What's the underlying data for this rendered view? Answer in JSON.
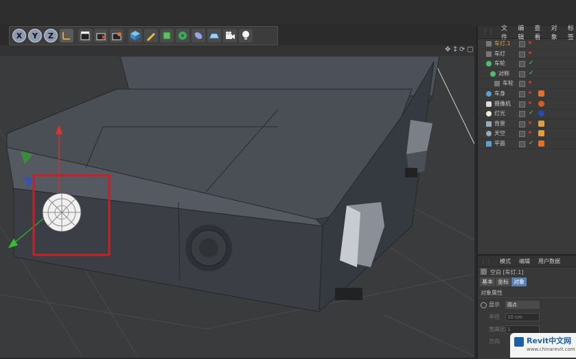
{
  "toolbar": {
    "axis_x": "X",
    "axis_y": "Y",
    "axis_z": "Z"
  },
  "object_manager": {
    "menu": [
      "文件",
      "编辑",
      "查看",
      "对象",
      "标签"
    ],
    "items": [
      {
        "name": "车灯.1",
        "highlight": true
      },
      {
        "name": "车灯"
      },
      {
        "name": "车轮"
      },
      {
        "name": "对称"
      },
      {
        "name": "车轮"
      },
      {
        "name": "车身"
      },
      {
        "name": "摄像机"
      },
      {
        "name": "灯光"
      },
      {
        "name": "背景"
      },
      {
        "name": "天空"
      },
      {
        "name": "平面"
      }
    ]
  },
  "attributes": {
    "menu": [
      "模式",
      "编辑",
      "用户数据"
    ],
    "object_title": "空白 [车灯.1]",
    "tabs": [
      "基本",
      "坐标",
      "对象"
    ],
    "active_tab": "对象",
    "section": "对象属性",
    "display_label": "显示",
    "display_value": "圆点",
    "radius_label": "半径",
    "radius_value": "10 cm",
    "aspect_label": "宽高比",
    "aspect_value": "1",
    "orient_label": "方向"
  },
  "watermark": {
    "brand": "Revit中文网",
    "url": "www.chinarevit.com"
  },
  "colors": {
    "selection_box": "#cc1f1f",
    "highlight_item": "#e0a040",
    "check": "#5fd35f",
    "accent": "#5a7fb3"
  }
}
